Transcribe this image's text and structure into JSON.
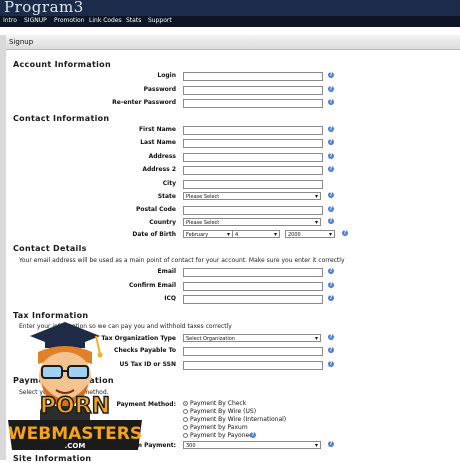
{
  "brand": "Program3",
  "nav": [
    "Intro",
    "SIGNUP",
    "Promotion",
    "Link Codes",
    "Stats",
    "Support"
  ],
  "panel_title": "Signup",
  "sections": {
    "account": "Account Information",
    "contact": "Contact Information",
    "details": "Contact Details",
    "tax": "Tax Information",
    "payment": "Payment Information",
    "site": "Site Information"
  },
  "account": {
    "login": "Login",
    "password": "Password",
    "reenter": "Re-enter Password"
  },
  "contact": {
    "first": "First Name",
    "last": "Last Name",
    "address": "Address",
    "address2": "Address 2",
    "city": "City",
    "state": "State",
    "state_value": "Please Select",
    "postal": "Postal Code",
    "country": "Country",
    "country_value": "Please Select",
    "dob": "Date of Birth",
    "dob_month": "February",
    "dob_day": "4",
    "dob_year": "2000"
  },
  "details": {
    "note": "Your email address will be used as a main point of contact for your account. Make sure you enter it correctly",
    "email": "Email",
    "confirm": "Confirm Email",
    "icq": "ICQ"
  },
  "tax": {
    "note": "Enter your information so we can pay you and withhold taxes correctly",
    "org_type": "Tax Organization Type",
    "org_value": "Select Organization",
    "payable": "Checks Payable To",
    "taxid": "US Tax ID or SSN"
  },
  "payment": {
    "note": "Select your payment method.",
    "method": "Payment Method:",
    "options": [
      "Payment By Check",
      "Payment By Wire (US)",
      "Payment By Wire (International)",
      "Payment by Paxum",
      "Payment by Payoneer"
    ],
    "selected_index": 0,
    "min_label": "Minimum Payment:",
    "min_value": "300"
  },
  "watermark": {
    "line1": "PORN",
    "line2": "WEBMASTERS",
    "line3": ".COM"
  },
  "colors": {
    "titlebar": "#1c2b4a",
    "navbar": "#0d1526",
    "help": "#4c7fd2"
  }
}
